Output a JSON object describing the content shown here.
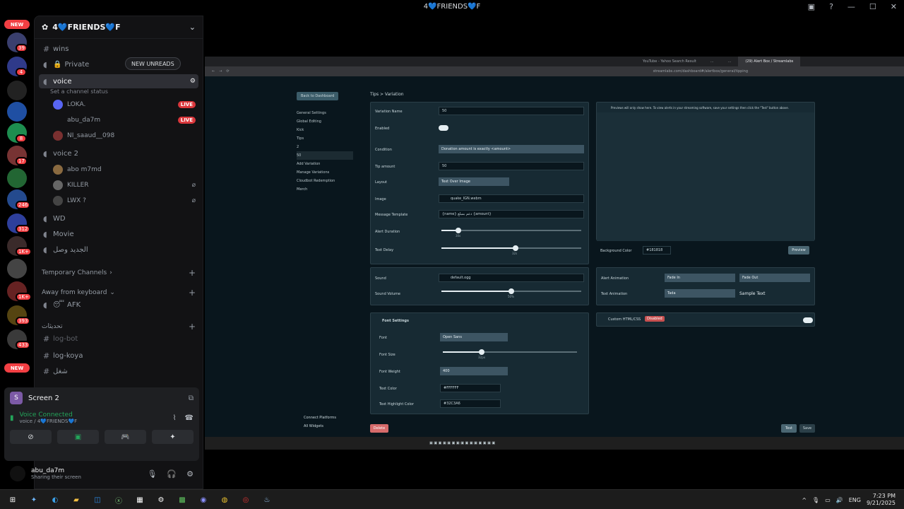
{
  "window": {
    "title": "4💙FRIENDS💙F"
  },
  "rail": {
    "badges": [
      "NEW",
      "39",
      "4",
      "8",
      "17",
      "246",
      "312",
      "1K+",
      "1K+",
      "393",
      "433",
      "NEW"
    ]
  },
  "guild": {
    "name": "4💙FRIENDS💙F"
  },
  "new_unreads": "NEW UNREADS",
  "channels": {
    "wins": "wins",
    "private": "Private",
    "voice": "voice",
    "voice_status": "Set a channel status",
    "voice2": "voice 2",
    "wd": "WD",
    "movie": "Movie",
    "arabic1": "الجديد وصل",
    "temp_cat": "Temporary Channels",
    "afk_cat": "Away from keyboard",
    "afk": "AFK",
    "arabic_cat": "تحديثات",
    "logbot": "log-bot",
    "logkoya": "log-koya",
    "arabic2": "شغل"
  },
  "voice_users": [
    {
      "name": "LOKA.",
      "live": "LIVE"
    },
    {
      "name": "abu_da7m",
      "live": "LIVE"
    },
    {
      "name": "NI_saaud__098",
      "live": ""
    }
  ],
  "voice2_users": [
    {
      "name": "abo m7md"
    },
    {
      "name": "KILLER"
    },
    {
      "name": "LWX ?"
    }
  ],
  "voice_panel": {
    "screen_title": "Screen 2",
    "connected": "Voice Connected",
    "connected_sub": "voice / 4💙FRIENDS💙F"
  },
  "user_panel": {
    "name": "abu_da7m",
    "status": "Sharing their screen"
  },
  "stream": {
    "tabs": [
      "YouTube - Yahoo Search Result",
      "...",
      "...",
      "(29) Alert Box / Streamlabs"
    ],
    "url": "streamlabs.com/dashboard#/alertbox/general/tipping",
    "back": "Back to Dashboard",
    "nav": [
      "General Settings",
      "Global Editing",
      "Kick",
      "Tips",
      "2",
      "50",
      "Add Variation",
      "Manage Variations",
      "Cloudbot Redemption",
      "Merch"
    ],
    "breadcrumb": "Tips > Variation",
    "preview_note": "Previews will only show here. To view alerts in your streaming software, save your settings then click the \"Test\" button above.",
    "fields": {
      "variation_name_label": "Variation Name",
      "variation_name": "50",
      "enabled_label": "Enabled",
      "condition_label": "Condition",
      "condition": "Donation amount is exactly <amount>",
      "tip_amount_label": "Tip amount",
      "tip_amount": "50",
      "layout_label": "Layout",
      "layout": "Text Over Image",
      "image_label": "Image",
      "image": "quake_IGN.webm",
      "message_label": "Message Template",
      "message": "{name} دعم بمبلغ {amount}",
      "alert_duration_label": "Alert Duration",
      "alert_duration": "30s",
      "text_delay_label": "Text Delay",
      "text_delay": "32s",
      "bg_color_label": "Background Color",
      "bg_color": "#181818",
      "preview_btn": "Preview",
      "sound_label": "Sound",
      "sound": "default.ogg",
      "volume_label": "Sound Volume",
      "volume": "50%",
      "alert_anim_label": "Alert Animation",
      "anim_in": "Fade In",
      "anim_out": "Fade Out",
      "text_anim_label": "Text Animation",
      "text_anim": "Tada",
      "sample": "Sample Text",
      "font_settings": "Font Settings",
      "font_label": "Font",
      "font": "Open Sans",
      "font_size_label": "Font Size",
      "font_size": "32px",
      "font_weight_label": "Font Weight",
      "font_weight": "400",
      "text_color_label": "Text Color",
      "text_color": "#FFFFFF",
      "highlight_label": "Text Highlight Color",
      "highlight": "#32C3A6",
      "custom_html": "Custom HTML/CSS",
      "disabled": "Disabled",
      "connect": "Connect Platforms",
      "all_widgets": "All Widgets",
      "delete": "Delete",
      "test": "Test",
      "save": "Save"
    },
    "alert_duration_fraction": 0.12,
    "text_delay_fraction": 0.53,
    "volume_fraction": 0.5,
    "font_size_fraction": 0.29
  },
  "taskbar": {
    "lang": "ENG",
    "time": "7:23 PM",
    "date": "9/21/2025"
  }
}
